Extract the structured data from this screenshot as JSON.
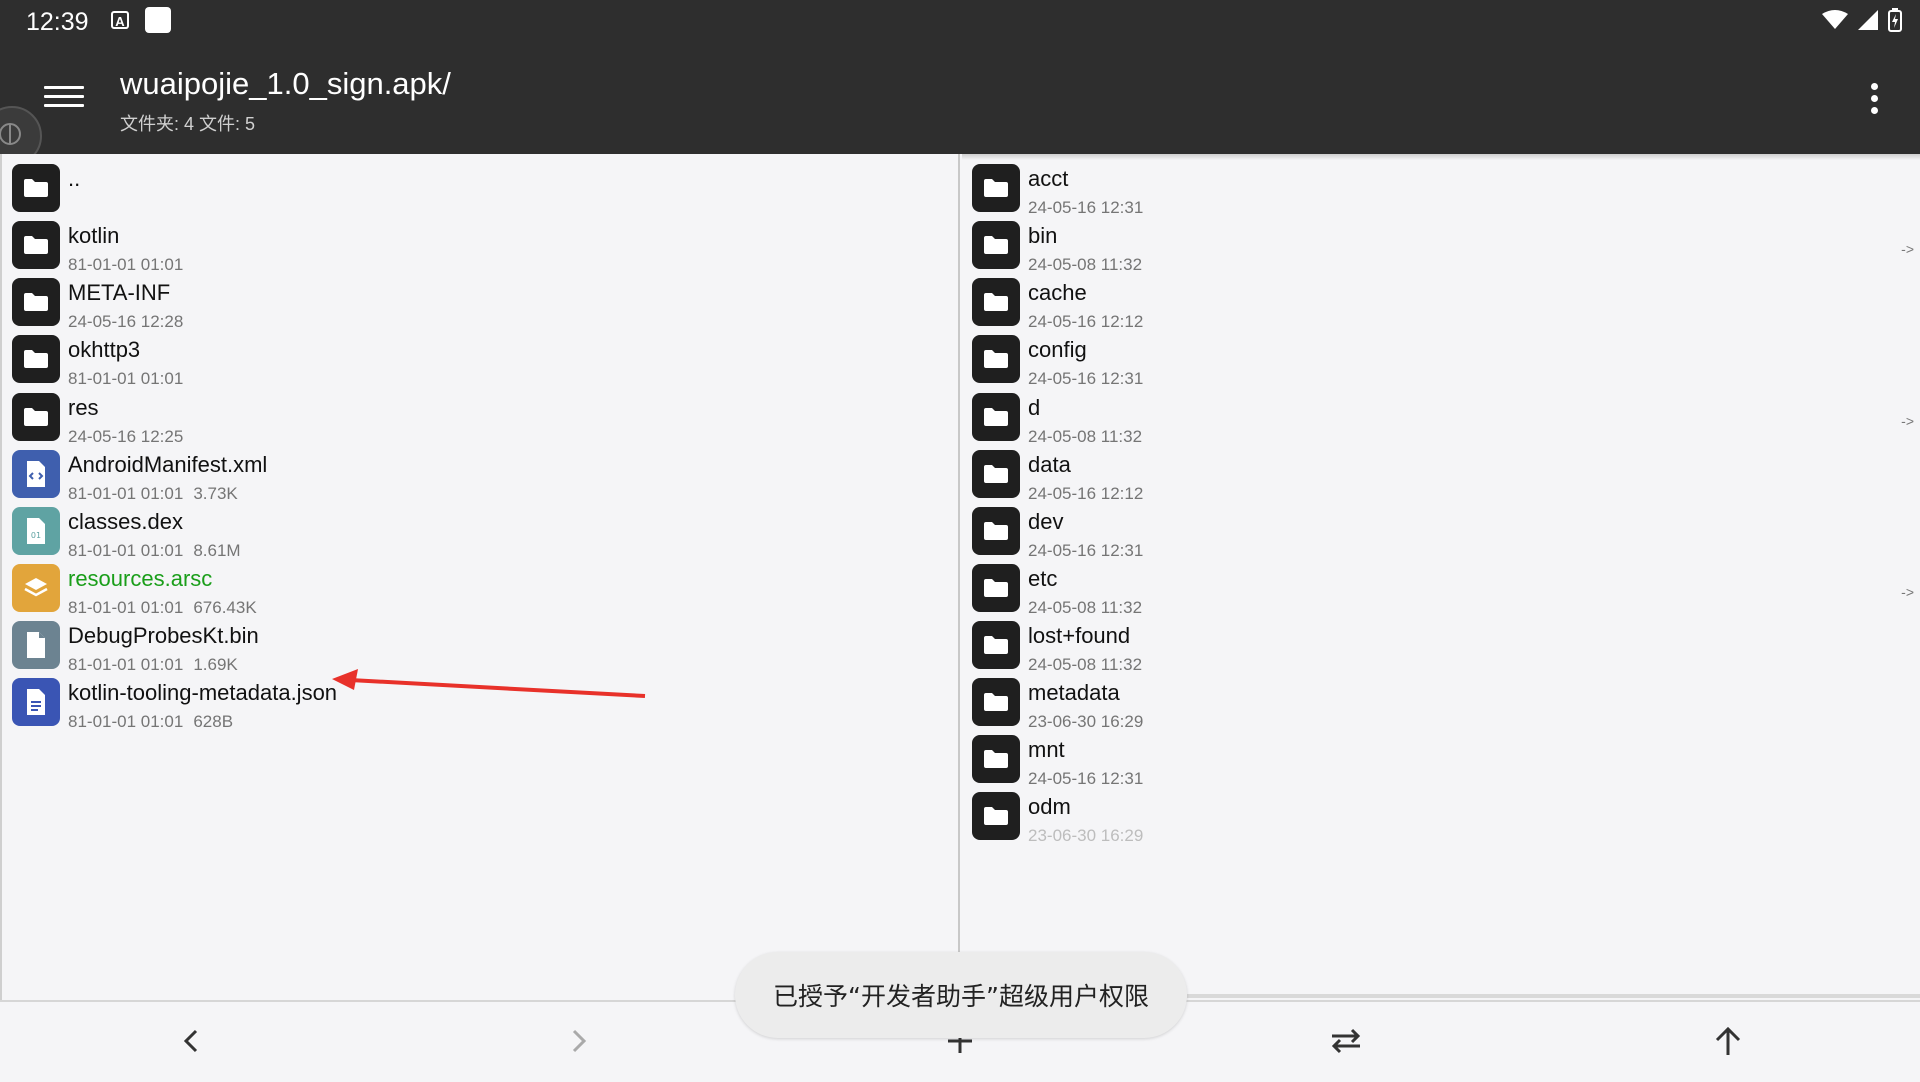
{
  "status_bar": {
    "time": "12:39",
    "badge": "A"
  },
  "app_bar": {
    "title": "wuaipojie_1.0_sign.apk/",
    "subtitle": "文件夹: 4  文件: 5",
    "menu_icon": "hamburger-menu-icon",
    "more_icon": "more-vert-icon"
  },
  "left_panel": {
    "items": [
      {
        "name": "..",
        "date": "",
        "size": "",
        "type": "folder"
      },
      {
        "name": "kotlin",
        "date": "81-01-01 01:01",
        "size": "",
        "type": "folder"
      },
      {
        "name": "META-INF",
        "date": "24-05-16 12:28",
        "size": "",
        "type": "folder"
      },
      {
        "name": "okhttp3",
        "date": "81-01-01 01:01",
        "size": "",
        "type": "folder"
      },
      {
        "name": "res",
        "date": "24-05-16 12:25",
        "size": "",
        "type": "folder"
      },
      {
        "name": "AndroidManifest.xml",
        "date": "81-01-01 01:01",
        "size": "3.73K",
        "type": "xml"
      },
      {
        "name": "classes.dex",
        "date": "81-01-01 01:01",
        "size": "8.61M",
        "type": "dex"
      },
      {
        "name": "resources.arsc",
        "date": "81-01-01 01:01",
        "size": "676.43K",
        "type": "arsc"
      },
      {
        "name": "DebugProbesKt.bin",
        "date": "81-01-01 01:01",
        "size": "1.69K",
        "type": "bin"
      },
      {
        "name": "kotlin-tooling-metadata.json",
        "date": "81-01-01 01:01",
        "size": "628B",
        "type": "json"
      }
    ]
  },
  "right_panel": {
    "items": [
      {
        "name": "acct",
        "date": "24-05-16 12:31",
        "link": ""
      },
      {
        "name": "bin",
        "date": "24-05-08 11:32",
        "link": "->"
      },
      {
        "name": "cache",
        "date": "24-05-16 12:12",
        "link": ""
      },
      {
        "name": "config",
        "date": "24-05-16 12:31",
        "link": ""
      },
      {
        "name": "d",
        "date": "24-05-08 11:32",
        "link": "->"
      },
      {
        "name": "data",
        "date": "24-05-16 12:12",
        "link": ""
      },
      {
        "name": "dev",
        "date": "24-05-16 12:31",
        "link": ""
      },
      {
        "name": "etc",
        "date": "24-05-08 11:32",
        "link": "->"
      },
      {
        "name": "lost+found",
        "date": "24-05-08 11:32",
        "link": ""
      },
      {
        "name": "metadata",
        "date": "23-06-30 16:29",
        "link": ""
      },
      {
        "name": "mnt",
        "date": "24-05-16 12:31",
        "link": ""
      },
      {
        "name": "odm",
        "date": "23-06-30 16:29",
        "link": ""
      }
    ]
  },
  "toast": {
    "text": "已授予“开发者助手”超级用户权限"
  },
  "toolbar": {
    "icons": [
      "back-icon",
      "forward-icon",
      "add-icon",
      "swap-icon",
      "up-icon"
    ]
  },
  "colors": {
    "bar": "#2e2e2e",
    "highlight": "#1a9e1a",
    "xml_icon": "#3f5fae",
    "dex_icon": "#5fa3a3",
    "arsc_icon": "#e2a53b",
    "bin_icon": "#6c8391",
    "json_icon": "#3a55b4",
    "arrow": "#e8312a"
  }
}
